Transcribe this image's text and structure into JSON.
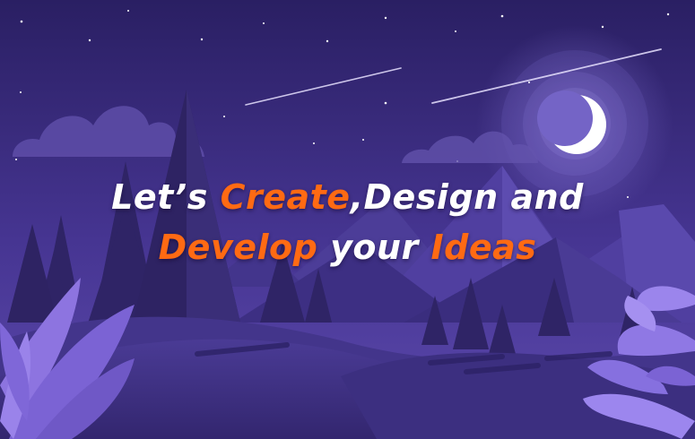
{
  "headline": {
    "line1_part1": "Let’s ",
    "line1_part2": "Create",
    "line1_part3": ",Design and",
    "line2_part1": "Develop",
    "line2_part2": " your ",
    "line2_part3": "Ideas"
  },
  "colors": {
    "sky_top": "#2b2064",
    "sky_bottom": "#5a46a8",
    "accent_orange": "#ff6a13",
    "moon": "#ffffff",
    "tree_dark": "#2e2363",
    "hill_front": "#3b2d7a",
    "leaf_light": "#8d74e0"
  },
  "icons": [
    "moon-icon",
    "shooting-star-icon",
    "cloud-icon",
    "pine-tree-icon",
    "leaf-plant-icon"
  ]
}
